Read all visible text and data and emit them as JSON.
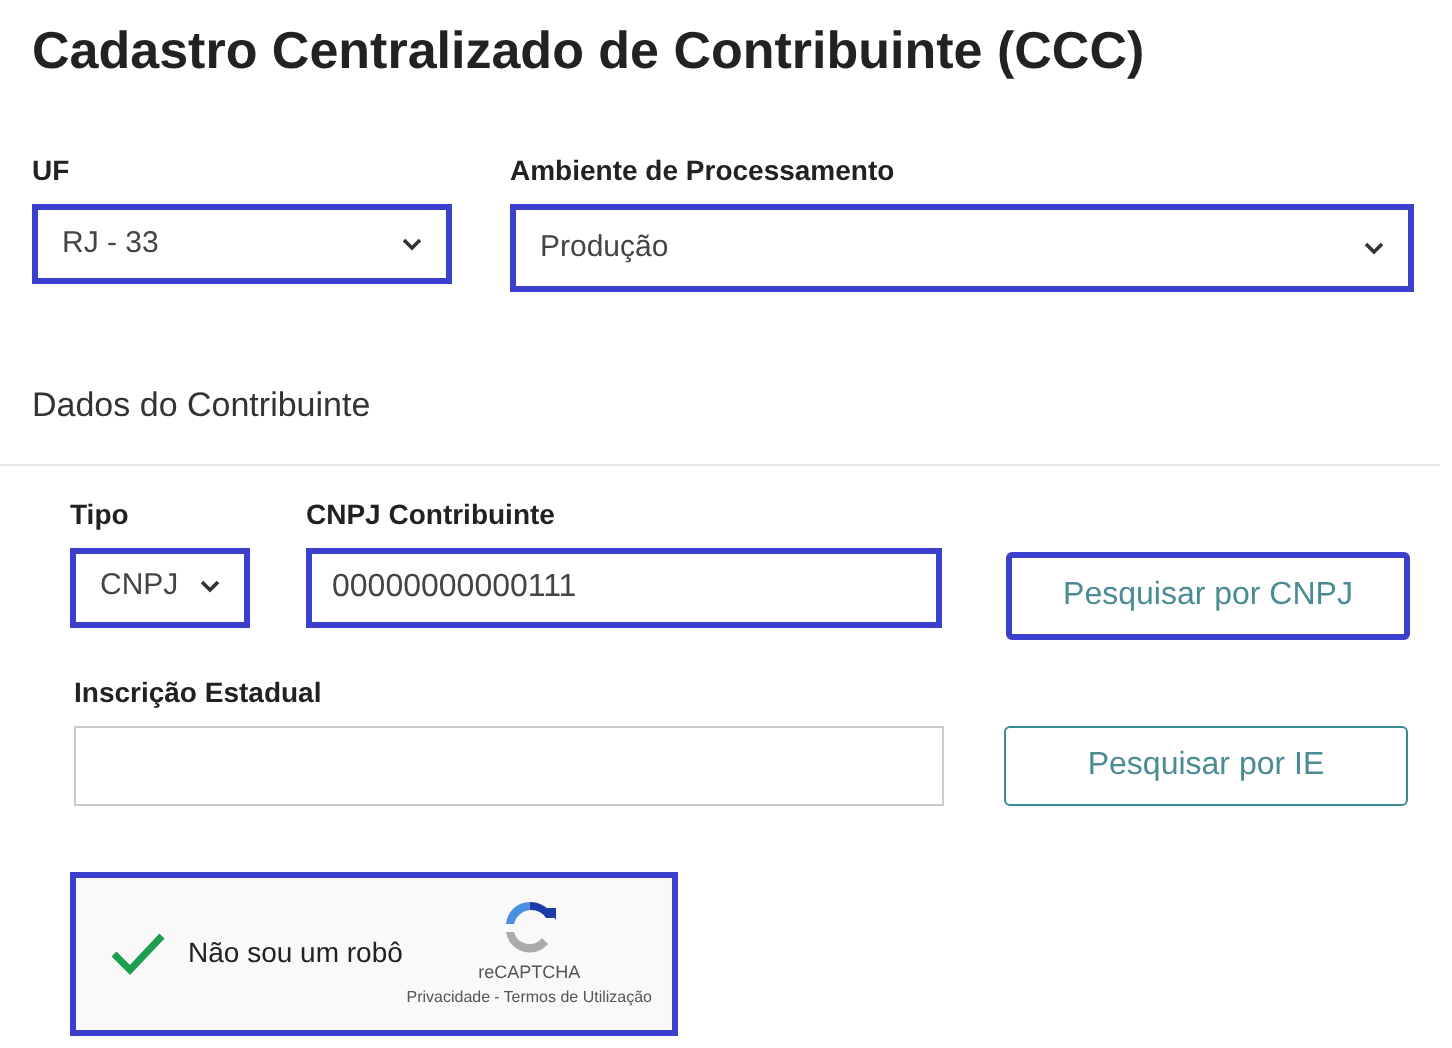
{
  "title": "Cadastro Centralizado de Contribuinte (CCC)",
  "uf": {
    "label": "UF",
    "value": "RJ - 33",
    "highlighted": true
  },
  "ambiente": {
    "label": "Ambiente de Processamento",
    "value": "Produção",
    "highlighted": true
  },
  "section_title": "Dados do Contribuinte",
  "tipo": {
    "label": "Tipo",
    "value": "CNPJ",
    "highlighted": true
  },
  "cnpj": {
    "label": "CNPJ Contribuinte",
    "value": "00000000000111",
    "highlighted": true
  },
  "cnpj_button": {
    "label": "Pesquisar por CNPJ",
    "highlighted": true
  },
  "ie": {
    "label": "Inscrição Estadual",
    "highlighted": false
  },
  "ie_button": {
    "label": "Pesquisar por IE",
    "highlighted": false
  },
  "captcha": {
    "label": "Não sou um robô",
    "checked": true,
    "brand": "reCAPTCHA",
    "privacy": "Privacidade",
    "separator": "-",
    "terms": "Termos de Utilização",
    "highlighted": true
  }
}
